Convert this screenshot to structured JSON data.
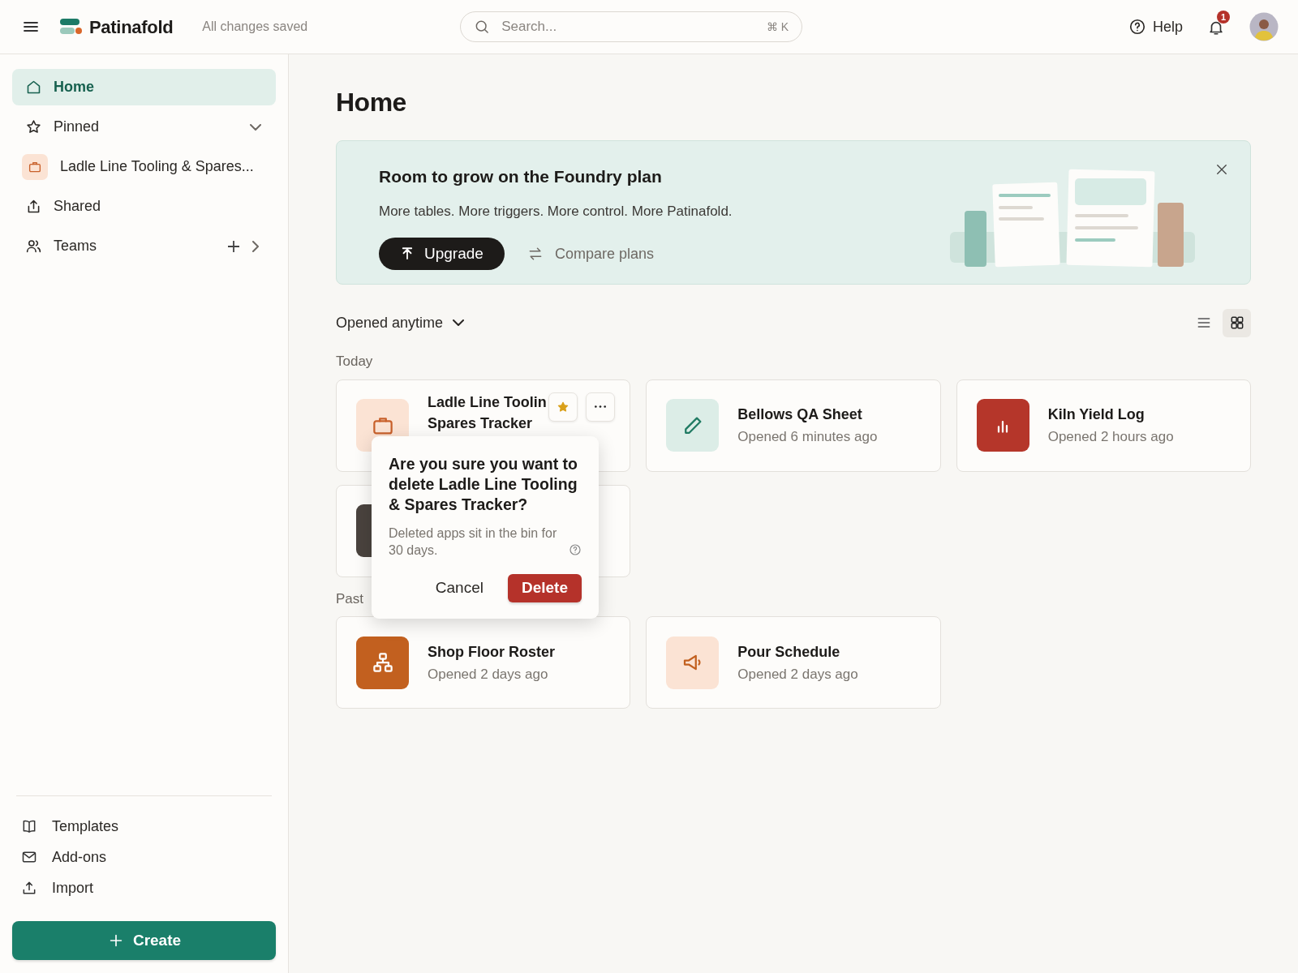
{
  "header": {
    "app_name": "Patinafold",
    "save_status": "All changes saved",
    "search": {
      "placeholder": "Search...",
      "shortcut": "⌘ K"
    },
    "help": "Help",
    "notification_count": "1"
  },
  "sidebar": {
    "items": [
      {
        "kind": "home",
        "label": "Home",
        "selected": true
      },
      {
        "kind": "pinned",
        "label": "Pinned",
        "selected": false,
        "expanded": true
      },
      {
        "kind": "app",
        "label": "Ladle Line Tooling & Spares...",
        "selected": false,
        "color": "#c8602a"
      },
      {
        "kind": "shared",
        "label": "Shared",
        "selected": false
      },
      {
        "kind": "teams",
        "label": "Teams",
        "selected": false
      }
    ],
    "footer_items": [
      {
        "kind": "book",
        "label": "Templates"
      },
      {
        "kind": "mail",
        "label": "Add-ons"
      },
      {
        "kind": "upload",
        "label": "Import"
      }
    ],
    "create_button": "Create"
  },
  "page_title": "Home",
  "banner": {
    "title": "Room to grow on the Foundry plan",
    "text": "More tables. More triggers. More control. More Patinafold.",
    "primary_button": "Upgrade",
    "secondary_button": "Compare plans"
  },
  "filter": {
    "label": "Opened anytime"
  },
  "view_toggle": [
    {
      "kind": "list",
      "selected": false
    },
    {
      "kind": "grid",
      "selected": true
    }
  ],
  "sections": [
    {
      "label": "Today",
      "cards": [
        {
          "kind": "briefcase",
          "color": "#c8602a",
          "title_lines": [
            "Ladle Line Toolin",
            "Spares Tracker"
          ],
          "starred": true
        },
        {
          "kind": "pencil",
          "color": "#1f7a62",
          "title_lines": [
            "Bellows QA Sheet"
          ],
          "subtitle": "Opened 6 minutes ago"
        },
        {
          "kind": "chart",
          "color": "#b5362a",
          "title_lines": [
            "Kiln Yield Log"
          ],
          "subtitle": "Opened 2 hours ago"
        },
        {
          "kind": "blank",
          "color": "#4a433e"
        }
      ]
    },
    {
      "label": "Past",
      "cards": [
        {
          "kind": "network",
          "color": "#c2601f",
          "title_lines": [
            "Shop Floor Roster"
          ],
          "subtitle": "Opened 2 days ago"
        },
        {
          "kind": "megaphone",
          "color": "#c2601f",
          "title_lines": [
            "Pour Schedule"
          ],
          "subtitle": "Opened 2 days ago"
        }
      ]
    }
  ],
  "confirm_popover": {
    "title": "Are you sure you want to delete Ladle Line Tooling & Spares Tracker?",
    "text": "Deleted apps sit in the bin for 30 days.",
    "cancel": "Cancel",
    "confirm": "Delete"
  }
}
